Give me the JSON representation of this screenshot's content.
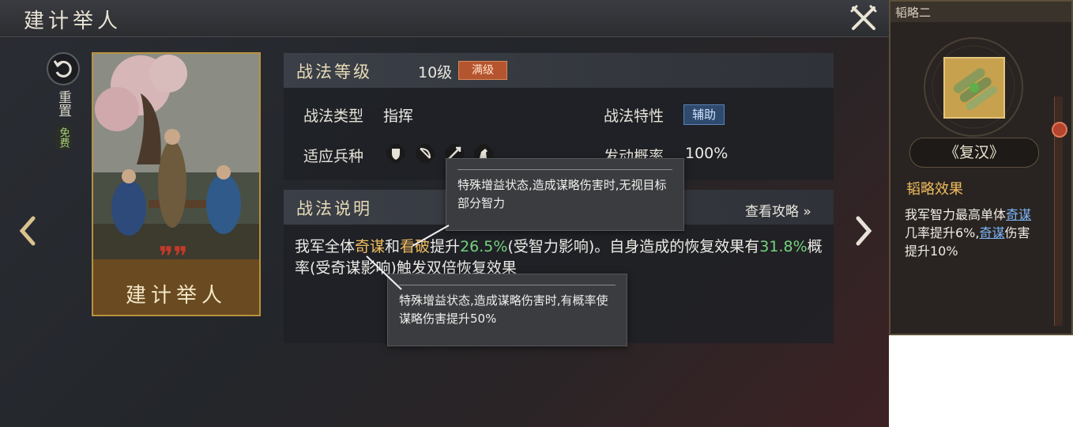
{
  "header": {
    "title": "建计举人"
  },
  "reset": {
    "label": "重置",
    "free": "免费"
  },
  "card": {
    "name": "建计举人"
  },
  "level_section": {
    "title": "战法等级",
    "level": "10级",
    "max_badge": "满级",
    "type_label": "战法类型",
    "type_value": "指挥",
    "trait_label": "战法特性",
    "trait_value": "辅助",
    "unit_label": "适应兵种",
    "units": [
      "shield-icon",
      "bow-icon",
      "spear-icon",
      "horse-icon"
    ],
    "chance_label": "发动概率",
    "chance_value": "100%"
  },
  "desc_section": {
    "title": "战法说明",
    "guide_link": "查看攻略 »",
    "p1": "我军全体",
    "kw1": "奇谋",
    "p2": "和",
    "kw2": "看破",
    "p3": "提升",
    "v1": "26.5%",
    "p4": "(受智力影响)。自身造成的恢复效果有",
    "v2": "31.8%",
    "p5": "概率(受奇谋影响)触发双倍恢复效果"
  },
  "tooltips": [
    {
      "text": "特殊增益状态,造成谋略伤害时,无视目标部分智力"
    },
    {
      "text": "特殊增益状态,造成谋略伤害时,有概率使谋略伤害提升50%"
    }
  ],
  "side_panel": {
    "tab": "韬略二",
    "item_name": "《复汉》",
    "effect_title": "韬略效果",
    "effect_p1": "我军智力最高单体",
    "effect_kw1": "奇谋",
    "effect_p2": "几率提升6%,",
    "effect_kw2": "奇谋",
    "effect_p3": "伤害提升10%"
  },
  "colors": {
    "keyword": "#f0bd5f",
    "percent": "#76d37d",
    "gold_border": "#b8913f",
    "badge_red": "#b5552f",
    "link_blue": "#7cb4f5"
  }
}
